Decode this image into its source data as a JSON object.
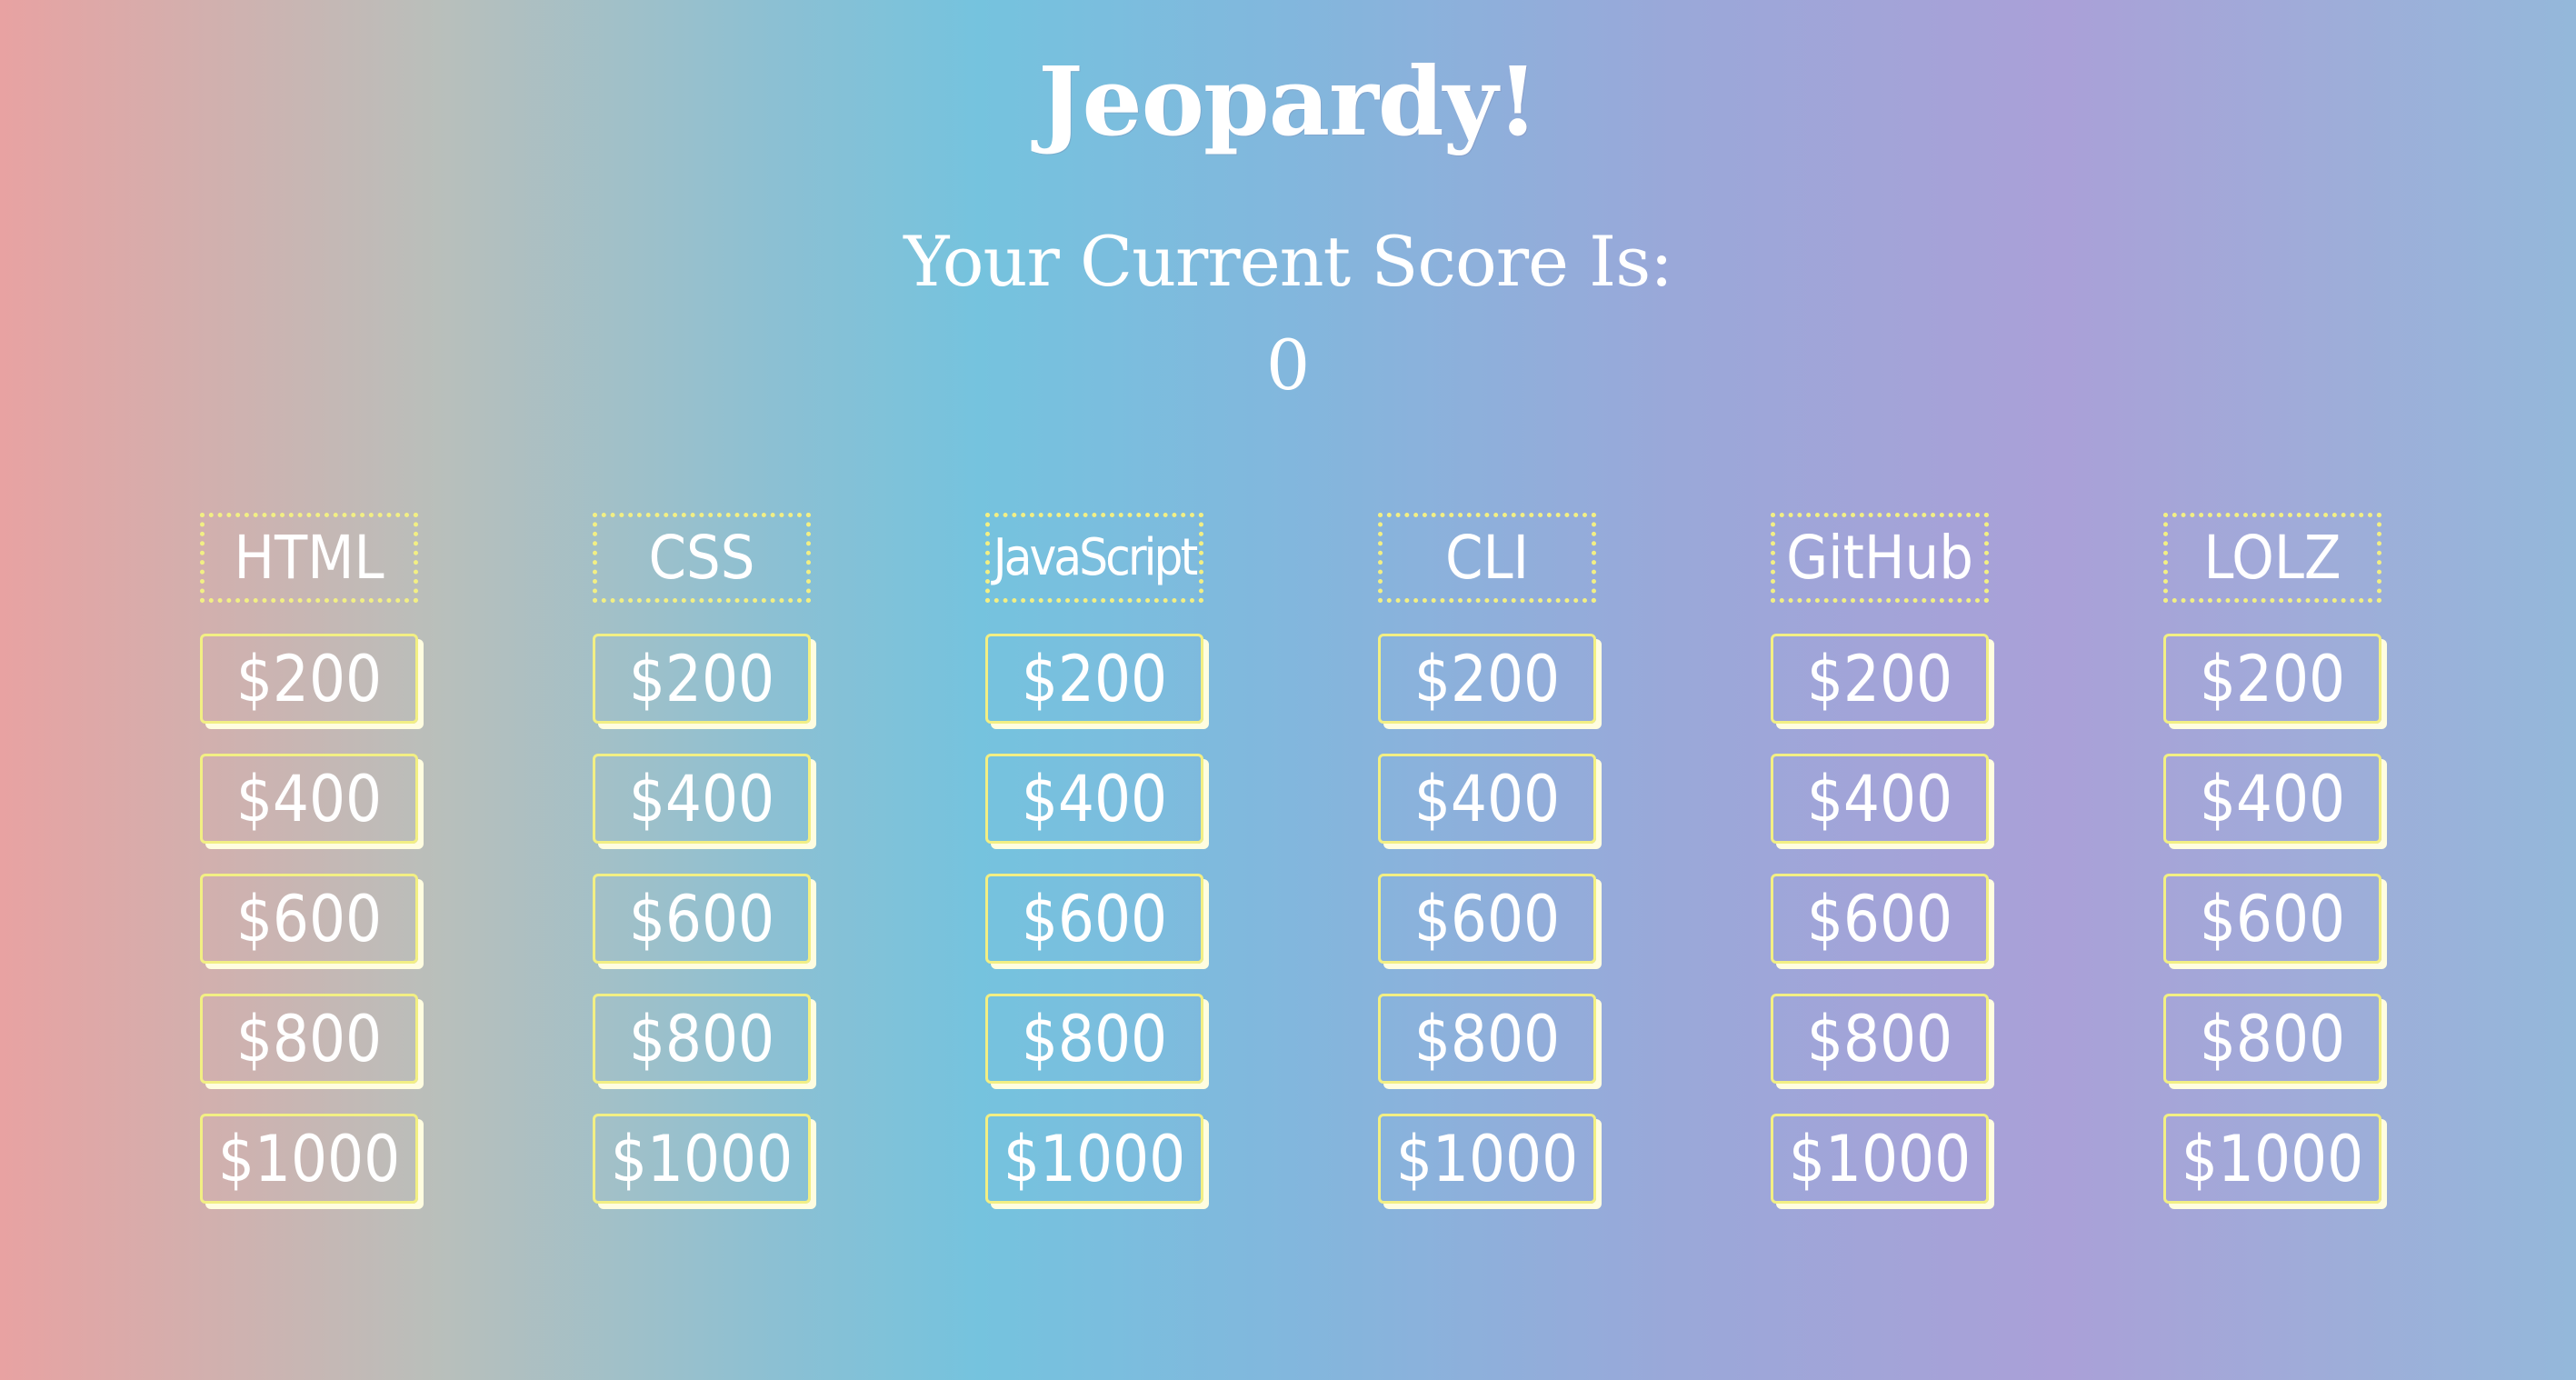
{
  "header": {
    "title": "Jeopardy!",
    "score_label": "Your Current Score Is:",
    "score_value": "0"
  },
  "board": {
    "categories": [
      {
        "name": "HTML",
        "values": [
          "$200",
          "$400",
          "$600",
          "$800",
          "$1000"
        ]
      },
      {
        "name": "CSS",
        "values": [
          "$200",
          "$400",
          "$600",
          "$800",
          "$1000"
        ]
      },
      {
        "name": "JavaScript",
        "values": [
          "$200",
          "$400",
          "$600",
          "$800",
          "$1000"
        ]
      },
      {
        "name": "CLI",
        "values": [
          "$200",
          "$400",
          "$600",
          "$800",
          "$1000"
        ]
      },
      {
        "name": "GitHub",
        "values": [
          "$200",
          "$400",
          "$600",
          "$800",
          "$1000"
        ]
      },
      {
        "name": "LOLZ",
        "values": [
          "$200",
          "$400",
          "$600",
          "$800",
          "$1000"
        ]
      }
    ]
  },
  "colors": {
    "accent_border": "#f2ef84",
    "tile_shadow": "#fffde0",
    "text": "#ffffff"
  }
}
